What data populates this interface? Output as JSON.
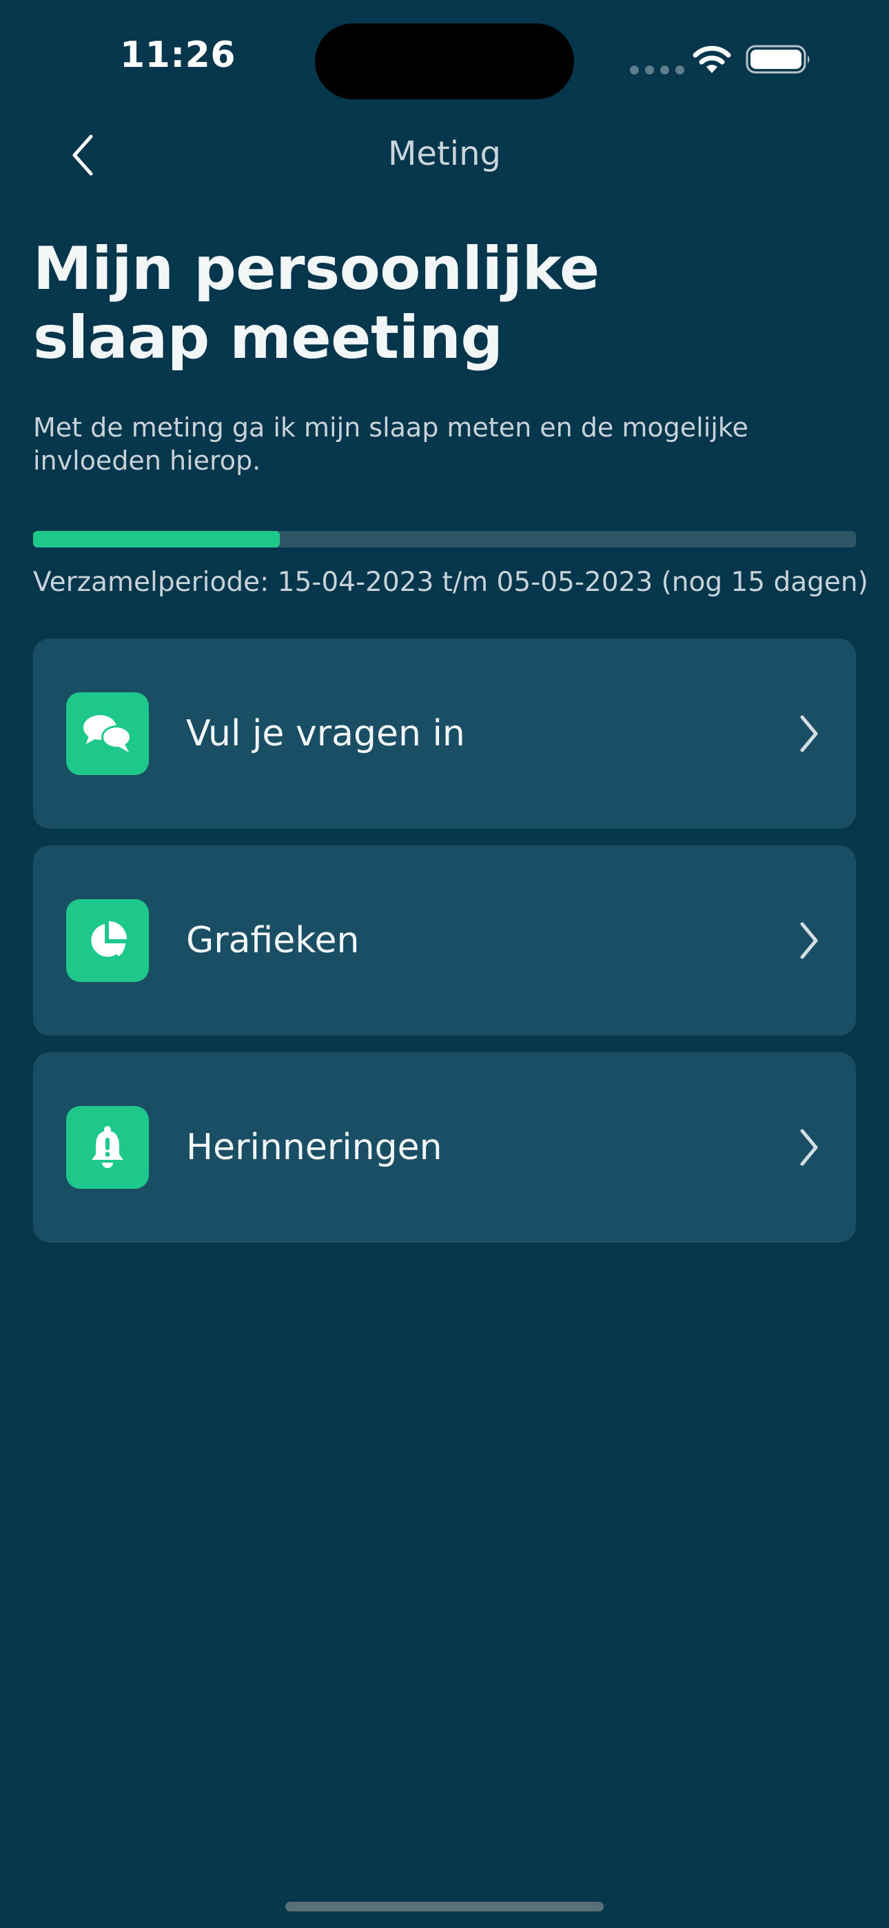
{
  "status_bar": {
    "time": "11:26",
    "icons": [
      "cellular-signal-icon",
      "wifi-icon",
      "battery-icon"
    ]
  },
  "nav": {
    "back_icon": "chevron-left-icon",
    "title": "Meting"
  },
  "header": {
    "title_line1": "Mijn persoonlijke",
    "title_line2": "slaap meeting",
    "subtitle": "Met de meting ga ik mijn slaap meten en de mogelijke invloeden hierop."
  },
  "progress": {
    "fraction": 0.3,
    "period_text": "Verzamelperiode: 15-04-2023 t/m 05-05-2023 (nog 15 dagen)"
  },
  "menu": {
    "items": [
      {
        "label": "Vul je vragen in",
        "icon": "chat-bubbles-icon"
      },
      {
        "label": "Grafieken",
        "icon": "pie-chart-icon"
      },
      {
        "label": "Herinneringen",
        "icon": "bell-icon"
      }
    ]
  },
  "colors": {
    "background": "#06364c",
    "card": "#1a4e64",
    "accent": "#1ec88a",
    "progress_track": "#2c5566"
  }
}
